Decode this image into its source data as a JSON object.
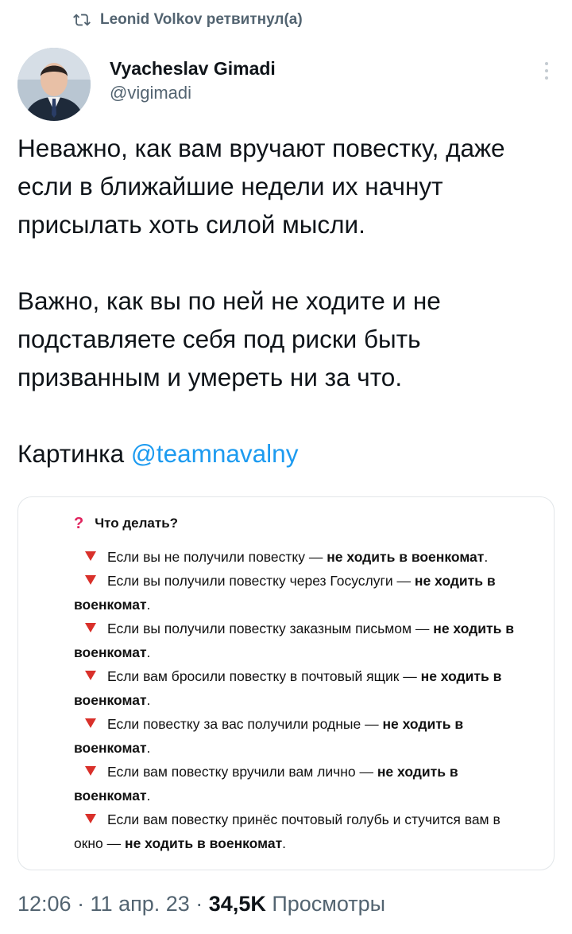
{
  "retweet": {
    "label": "Leonid Volkov ретвитнул(а)"
  },
  "author": {
    "name": "Vyacheslav Gimadi",
    "handle": "@vigimadi"
  },
  "tweet": {
    "p1": "Неважно, как вам вручают повестку, даже если в ближайшие недели их начнут присылать хоть силой мысли.",
    "p2": "Важно, как вы по ней не ходите и не подставляете себя под риски быть призванным и умереть ни за что.",
    "p3_text": "Картинка ",
    "p3_mention": "@teamnavalny"
  },
  "card": {
    "question_mark": "?",
    "title": "Что делать?",
    "items": [
      {
        "text": "Если вы не получили повестку — ",
        "bold": "не ходить в военкомат",
        "tail": "."
      },
      {
        "text": "Если вы получили повестку через Госуслуги — ",
        "bold": "не ходить в военкомат",
        "tail": "."
      },
      {
        "text": "Если вы получили повестку заказным письмом — ",
        "bold": "не ходить в военкомат",
        "tail": "."
      },
      {
        "text": "Если вам бросили повестку в почтовый ящик — ",
        "bold": "не ходить в военкомат",
        "tail": "."
      },
      {
        "text": "Если повестку за вас получили родные — ",
        "bold": "не ходить в военкомат",
        "tail": "."
      },
      {
        "text": "Если вам повестку вручили вам лично  — ",
        "bold": "не ходить в военкомат",
        "tail": "."
      },
      {
        "text": "Если вам повестку принёс почтовый голубь и стучится вам в окно — ",
        "bold": "не ходить в военкомат",
        "tail": "."
      }
    ]
  },
  "meta": {
    "time_date": "12:06 · 11 апр. 23 · ",
    "views_count": "34,5K",
    "views_label": " Просмотры"
  },
  "colors": {
    "accent": "#1d9bf0",
    "muted": "#536471",
    "triangle": "#d9302a"
  }
}
